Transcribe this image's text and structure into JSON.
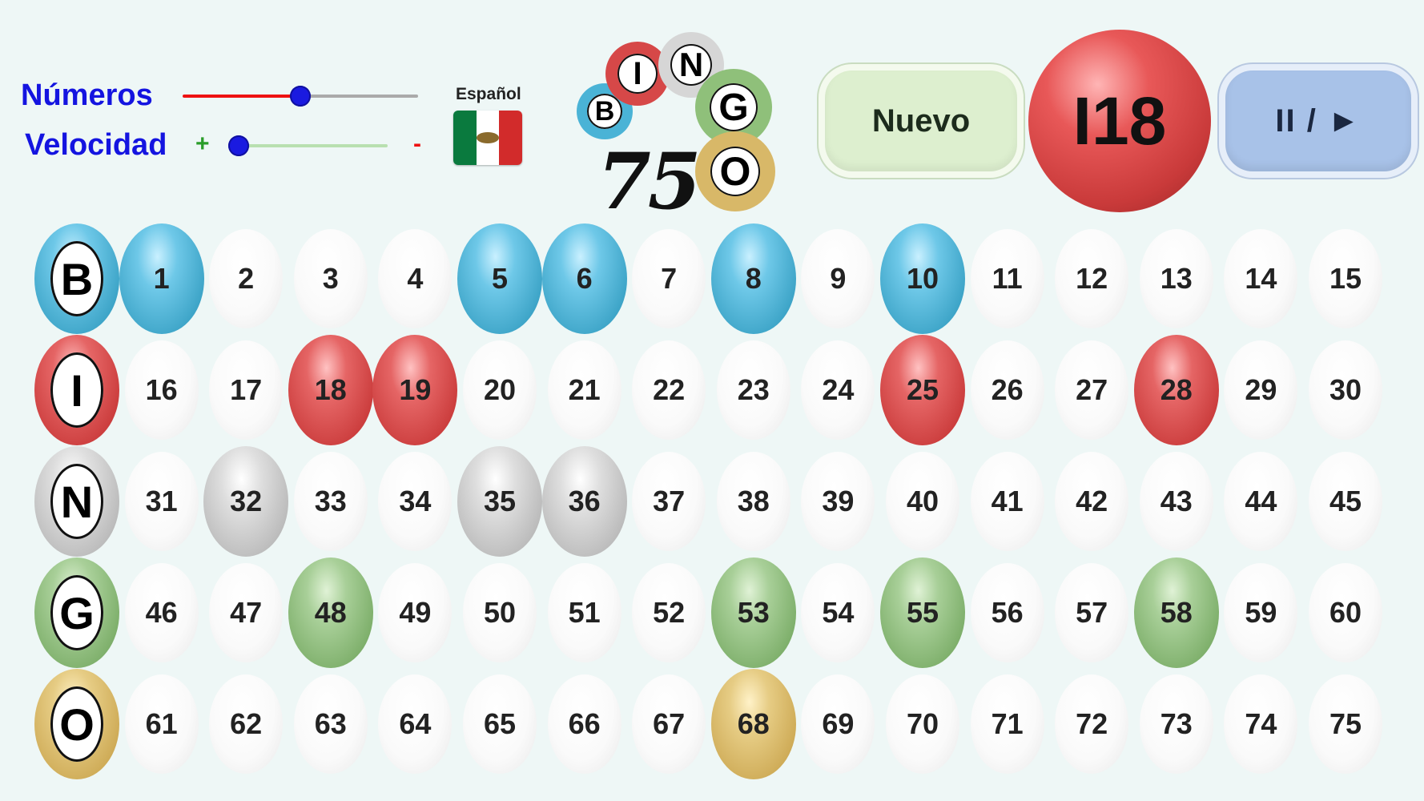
{
  "controls": {
    "numbers_label": "Números",
    "speed_label": "Velocidad",
    "plus": "+",
    "minus": "-",
    "numbers_slider_value": 0.5,
    "speed_slider_value": 0.0
  },
  "language": {
    "label": "Español",
    "flag_icon": "mexico-flag-icon"
  },
  "logo": {
    "letters": [
      "B",
      "I",
      "N",
      "G",
      "O"
    ],
    "number": "75"
  },
  "buttons": {
    "new_label": "Nuevo",
    "play_pause_label": "II / ►"
  },
  "current_ball": {
    "letter": "I",
    "number": "18",
    "display": "I18",
    "color": "#cc3e3e"
  },
  "colors": {
    "B": "#3ea5c8",
    "I": "#cc3e3e",
    "N": "#bcbcbc",
    "G": "#7fb06c",
    "O": "#cfac58"
  },
  "board": {
    "rows": [
      {
        "letter": "B",
        "numbers": [
          "1",
          "2",
          "3",
          "4",
          "5",
          "6",
          "7",
          "8",
          "9",
          "10",
          "11",
          "12",
          "13",
          "14",
          "15"
        ],
        "drawn": [
          "1",
          "5",
          "6",
          "8",
          "10"
        ]
      },
      {
        "letter": "I",
        "numbers": [
          "16",
          "17",
          "18",
          "19",
          "20",
          "21",
          "22",
          "23",
          "24",
          "25",
          "26",
          "27",
          "28",
          "29",
          "30"
        ],
        "drawn": [
          "18",
          "19",
          "25",
          "28"
        ]
      },
      {
        "letter": "N",
        "numbers": [
          "31",
          "32",
          "33",
          "34",
          "35",
          "36",
          "37",
          "38",
          "39",
          "40",
          "41",
          "42",
          "43",
          "44",
          "45"
        ],
        "drawn": [
          "32",
          "35",
          "36"
        ]
      },
      {
        "letter": "G",
        "numbers": [
          "46",
          "47",
          "48",
          "49",
          "50",
          "51",
          "52",
          "53",
          "54",
          "55",
          "56",
          "57",
          "58",
          "59",
          "60"
        ],
        "drawn": [
          "48",
          "53",
          "55",
          "58"
        ]
      },
      {
        "letter": "O",
        "numbers": [
          "61",
          "62",
          "63",
          "64",
          "65",
          "66",
          "67",
          "68",
          "69",
          "70",
          "71",
          "72",
          "73",
          "74",
          "75"
        ],
        "drawn": [
          "68"
        ]
      }
    ]
  }
}
